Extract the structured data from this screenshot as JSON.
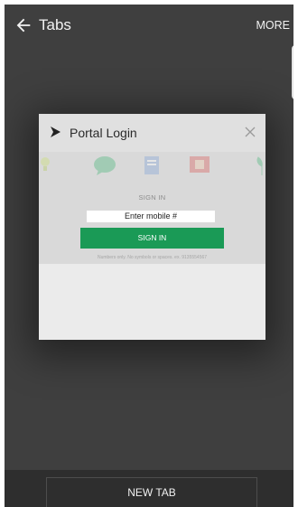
{
  "app_bar": {
    "title": "Tabs",
    "more_label": "MORE",
    "back_icon": "arrow-left-icon"
  },
  "tab_card": {
    "title": "Portal Login",
    "favicon": "arrow-right-icon",
    "close_icon": "close-icon",
    "preview": {
      "signin_heading": "SIGN IN",
      "mobile_value": "Enter mobile #",
      "signin_button_label": "SIGN IN",
      "hint": "Numbers only. No symbols or spaces. ex. 9135554567"
    }
  },
  "bottom_bar": {
    "new_tab_label": "NEW TAB"
  },
  "colors": {
    "background": "#3f3f3f",
    "card": "#ebebeb",
    "accent": "#1a9a56",
    "bottom_bar": "#2e2e2e"
  }
}
